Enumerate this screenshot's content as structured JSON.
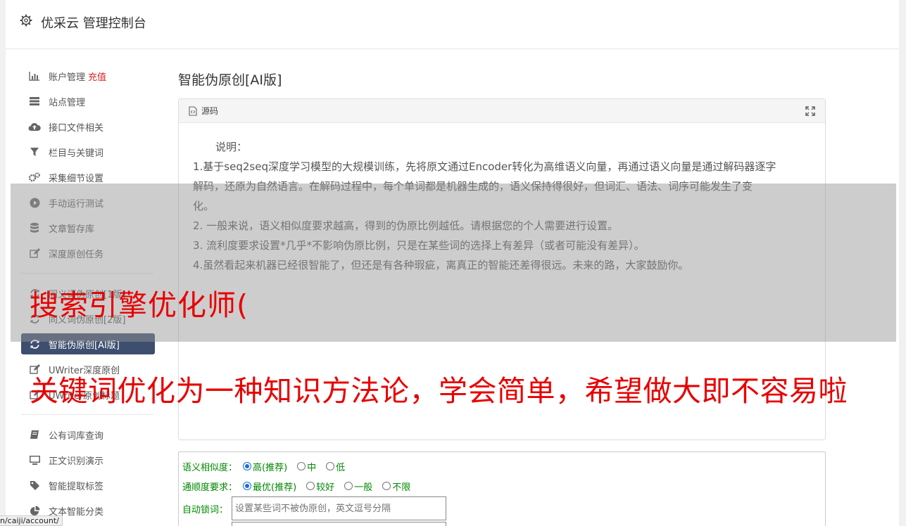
{
  "app": {
    "title": "优采云 管理控制台"
  },
  "sidebar": {
    "items": [
      {
        "label": "账户管理",
        "badge": "充值",
        "icon": "bar-chart-icon"
      },
      {
        "label": "站点管理",
        "icon": "server-icon"
      },
      {
        "label": "接口文件相关",
        "icon": "cloud-upload-icon"
      },
      {
        "label": "栏目与关键词",
        "icon": "filter-icon"
      },
      {
        "label": "采集细节设置",
        "icon": "gears-icon"
      },
      {
        "label": "手动运行测试",
        "icon": "play-icon"
      },
      {
        "label": "文章暂存库",
        "icon": "database-icon"
      },
      {
        "label": "深度原创任务",
        "icon": "edit-icon"
      },
      {
        "label": "同义词伪原创[1版]",
        "icon": "refresh-icon"
      },
      {
        "label": "同义词伪原创[2版]",
        "icon": "refresh-icon"
      },
      {
        "label": "智能伪原创[AI版]",
        "icon": "refresh-icon",
        "active": true
      },
      {
        "label": "UWriter深度原创",
        "icon": "edit-icon"
      },
      {
        "label": "UWriter原创标题",
        "icon": "edit-icon"
      },
      {
        "label": "公有词库查询",
        "icon": "book-icon"
      },
      {
        "label": "正文识别演示",
        "icon": "monitor-icon"
      },
      {
        "label": "智能提取标签",
        "icon": "tag-icon"
      },
      {
        "label": "文本智能分类",
        "icon": "pie-chart-icon"
      }
    ]
  },
  "main": {
    "title": "智能伪原创[AI版]",
    "source_label": "源码",
    "description": {
      "heading": "说明：",
      "lines": [
        "1.基于seq2seq深度学习模型的大规模训练，先将原文通过Encoder转化为高维语义向量，再通过语义向量是通过解码器逐字",
        "解码，还原为自然语言。在解码过程中，每个单词都是机器生成的，语义保持得很好，但词汇、语法、词序可能发生了变",
        "化。",
        "2. 一般来说，语义相似度要求越高，得到的伪原比例越低。请根据您的个人需要进行设置。",
        "3. 流利度要求设置*几乎*不影响伪原比例，只是在某些词的选择上有差异（或者可能没有差异）。",
        "4.虽然看起来机器已经很智能了，但还是有各种瑕疵，离真正的智能还差得很远。未来的路，大家鼓励你。"
      ]
    },
    "similarity": {
      "label": "语义相似度：",
      "options": [
        "高(推荐)",
        "中",
        "低"
      ],
      "selected": "高(推荐)"
    },
    "fluency": {
      "label": "通顺度要求：",
      "options": [
        "最优(推荐)",
        "较好",
        "一般",
        "不限"
      ],
      "selected": "最优(推荐)"
    },
    "autolock": {
      "label": "自动锁词：",
      "placeholder": "设置某些词不被伪原创，英文逗号分隔"
    }
  },
  "overlay": {
    "line1": "搜索引擎优化师(",
    "line2": "关键词优化为一种知识方法论，学会简单，希望做大即不容易啦"
  },
  "status": {
    "url": "n/caiji/account/"
  },
  "colors": {
    "active_nav": "#3d4e6e",
    "badge": "#e02020",
    "option_text": "#008800",
    "overlay_text": "#e80000"
  }
}
